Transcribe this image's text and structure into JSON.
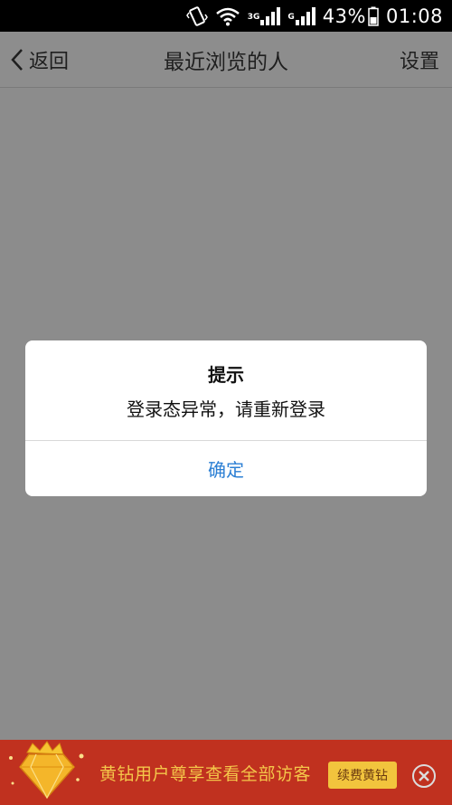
{
  "status_bar": {
    "network_3g": "3G",
    "network_g": "G",
    "battery": "43%",
    "time": "01:08",
    "icons": [
      "vibrate-icon",
      "wifi-icon",
      "signal-icon",
      "signal-icon",
      "battery-icon"
    ]
  },
  "nav": {
    "back_label": "返回",
    "title": "最近浏览的人",
    "settings_label": "设置"
  },
  "dialog": {
    "title": "提示",
    "message": "登录态异常，请重新登录",
    "confirm_label": "确定",
    "confirm_color": "#2b7fd4"
  },
  "banner": {
    "text": "黄钻用户尊享查看全部访客",
    "button_label": "续费黄钻",
    "background_color": "#c0311f",
    "accent_color": "#f2c43d",
    "icons": [
      "diamond-badge-icon",
      "close-icon"
    ]
  }
}
